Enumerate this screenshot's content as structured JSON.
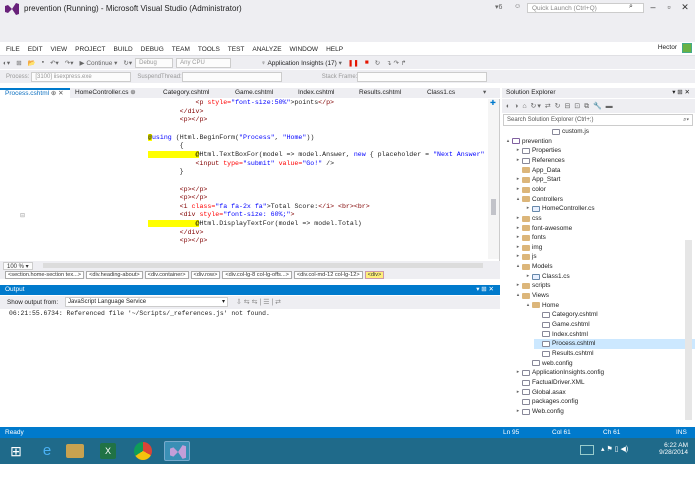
{
  "window": {
    "title": "prevention (Running) - Microsoft Visual Studio (Administrator)",
    "quick_launch": "Quick Launch (Ctrl+Q)",
    "user": "Hector"
  },
  "menu": [
    "FILE",
    "EDIT",
    "VIEW",
    "PROJECT",
    "BUILD",
    "DEBUG",
    "TEAM",
    "TOOLS",
    "TEST",
    "ANALYZE",
    "WINDOW",
    "HELP"
  ],
  "toolbar": {
    "continue": "Continue",
    "config": "Debug",
    "platform": "Any CPU",
    "insights": "Application Insights (17)",
    "process_label": "Process:",
    "process_value": "[3100] iisexpress.exe",
    "suspend": "Suspend",
    "thread_label": "Thread:",
    "stack_frame": "Stack Frame:"
  },
  "tabs": [
    "Process.cshtml",
    "HomeController.cs",
    "Category.cshtml",
    "Game.cshtml",
    "Index.cshtml",
    "Results.cshtml",
    "Class1.cs"
  ],
  "code": [
    {
      "parts": [
        [
          "            <p style=\"font-size:50%\">points</p>",
          ""
        ]
      ]
    },
    {
      "parts": [
        [
          "        </div>",
          ""
        ]
      ]
    },
    {
      "parts": [
        [
          "        <p></p>",
          ""
        ]
      ]
    },
    {
      "parts": [
        [
          "",
          ""
        ]
      ]
    },
    {
      "parts": [
        [
          "@",
          "rz"
        ],
        [
          "using (Html.BeginForm(\"Process\", \"Home\"))",
          ""
        ]
      ]
    },
    {
      "parts": [
        [
          "        {",
          ""
        ]
      ]
    },
    {
      "parts": [
        [
          "            @",
          "rz"
        ],
        [
          "Html.TextBoxFor(model => model.Answer, new { placeholder = \"Next Answer\" })",
          ""
        ]
      ]
    },
    {
      "parts": [
        [
          "            <input type=\"submit\" value=\"Go!\" />",
          ""
        ]
      ]
    },
    {
      "parts": [
        [
          "        }",
          ""
        ]
      ]
    },
    {
      "parts": [
        [
          "",
          ""
        ]
      ]
    },
    {
      "parts": [
        [
          "        <p></p>",
          ""
        ]
      ]
    },
    {
      "parts": [
        [
          "        <p></p>",
          ""
        ]
      ]
    },
    {
      "parts": [
        [
          "        <i class=\"fa fa-2x fa\">Total Score:</i> <br><br>",
          ""
        ]
      ]
    },
    {
      "parts": [
        [
          "        <div style=\"font-size: 60%;\">",
          ""
        ]
      ]
    },
    {
      "parts": [
        [
          "            @",
          "rz"
        ],
        [
          "Html.DisplayTextFor(model => model.Total)",
          ""
        ]
      ]
    },
    {
      "parts": [
        [
          "        </div>",
          ""
        ]
      ]
    },
    {
      "parts": [
        [
          "        <p></p>",
          ""
        ]
      ]
    }
  ],
  "zoom": "100 %",
  "breadcrumbs": [
    "<section.home-section tex...>",
    "<div.heading-about>",
    "<div.container>",
    "<div.row>",
    "<div.col-lg-8 col-lg-offs...>",
    "<div.col-md-12 col-lg-12>",
    "<div>"
  ],
  "output": {
    "title": "Output",
    "show_from": "Show output from:",
    "source": "JavaScript Language Service",
    "line": "06:21:55.6734: Referenced file '~/Scripts/_references.js' not found."
  },
  "solution": {
    "title": "Solution Explorer",
    "search": "Search Solution Explorer (Ctrl+;)",
    "items": [
      {
        "label": "custom.js",
        "depth": 4,
        "icon": "file",
        "arrow": ""
      },
      {
        "label": "prevention",
        "depth": 0,
        "icon": "proj",
        "arrow": "▴"
      },
      {
        "label": "Properties",
        "depth": 1,
        "icon": "file",
        "arrow": "▸"
      },
      {
        "label": "References",
        "depth": 1,
        "icon": "file",
        "arrow": "▸"
      },
      {
        "label": "App_Data",
        "depth": 1,
        "icon": "fold",
        "arrow": ""
      },
      {
        "label": "App_Start",
        "depth": 1,
        "icon": "fold",
        "arrow": "▸"
      },
      {
        "label": "color",
        "depth": 1,
        "icon": "fold",
        "arrow": "▸"
      },
      {
        "label": "Controllers",
        "depth": 1,
        "icon": "fold",
        "arrow": "▴"
      },
      {
        "label": "HomeController.cs",
        "depth": 2,
        "icon": "cs",
        "arrow": "▸"
      },
      {
        "label": "css",
        "depth": 1,
        "icon": "fold",
        "arrow": "▸"
      },
      {
        "label": "font-awesome",
        "depth": 1,
        "icon": "fold",
        "arrow": "▸"
      },
      {
        "label": "fonts",
        "depth": 1,
        "icon": "fold",
        "arrow": "▸"
      },
      {
        "label": "img",
        "depth": 1,
        "icon": "fold",
        "arrow": "▸"
      },
      {
        "label": "js",
        "depth": 1,
        "icon": "fold",
        "arrow": "▸"
      },
      {
        "label": "Models",
        "depth": 1,
        "icon": "fold",
        "arrow": "▴"
      },
      {
        "label": "Class1.cs",
        "depth": 2,
        "icon": "cs",
        "arrow": "▸"
      },
      {
        "label": "scripts",
        "depth": 1,
        "icon": "fold",
        "arrow": "▸"
      },
      {
        "label": "Views",
        "depth": 1,
        "icon": "fold",
        "arrow": "▴"
      },
      {
        "label": "Home",
        "depth": 2,
        "icon": "fold",
        "arrow": "▴"
      },
      {
        "label": "Category.cshtml",
        "depth": 3,
        "icon": "file",
        "arrow": ""
      },
      {
        "label": "Game.cshtml",
        "depth": 3,
        "icon": "file",
        "arrow": ""
      },
      {
        "label": "Index.cshtml",
        "depth": 3,
        "icon": "file",
        "arrow": ""
      },
      {
        "label": "Process.cshtml",
        "depth": 3,
        "icon": "file",
        "arrow": "",
        "selected": true
      },
      {
        "label": "Results.cshtml",
        "depth": 3,
        "icon": "file",
        "arrow": ""
      },
      {
        "label": "web.config",
        "depth": 2,
        "icon": "file",
        "arrow": ""
      },
      {
        "label": "ApplicationInsights.config",
        "depth": 1,
        "icon": "file",
        "arrow": "▸"
      },
      {
        "label": "FactualDriver.XML",
        "depth": 1,
        "icon": "file",
        "arrow": ""
      },
      {
        "label": "Global.asax",
        "depth": 1,
        "icon": "file",
        "arrow": "▸"
      },
      {
        "label": "packages.config",
        "depth": 1,
        "icon": "file",
        "arrow": ""
      },
      {
        "label": "Web.config",
        "depth": 1,
        "icon": "file",
        "arrow": "▸"
      }
    ]
  },
  "status": {
    "ready": "Ready",
    "ln": "Ln 95",
    "col": "Col 61",
    "ch": "Ch 61",
    "mode": "INS"
  },
  "clock": {
    "time": "6:22 AM",
    "date": "9/28/2014"
  },
  "colors": {
    "accent": "#007acc",
    "taskbar": "#1f6a8a"
  }
}
